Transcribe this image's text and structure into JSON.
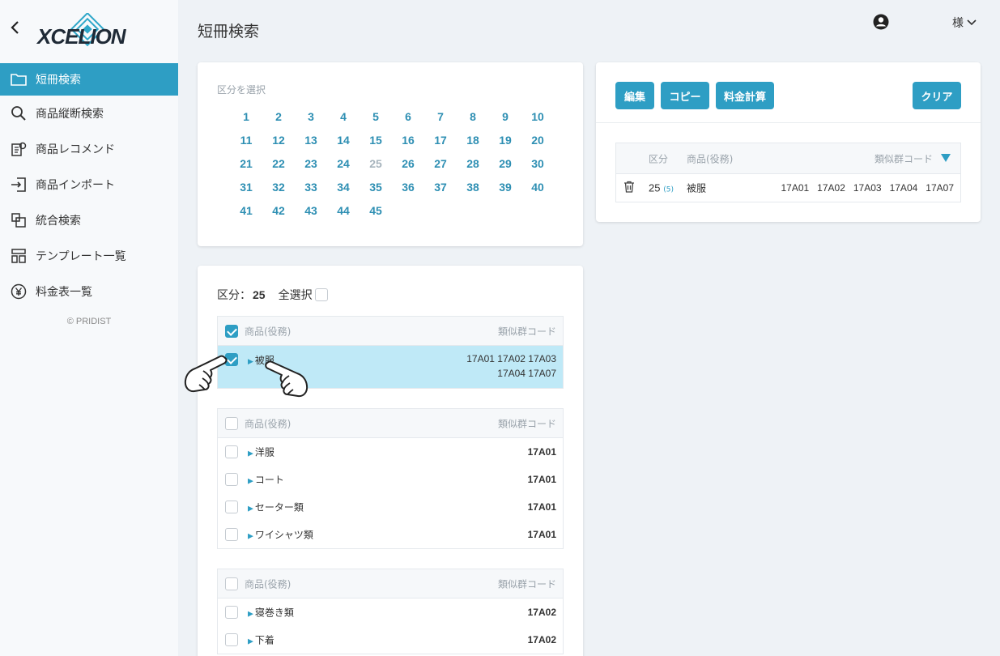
{
  "sidebar": {
    "items": [
      {
        "label": "短冊検索",
        "name": "sidebar-item-tanzaku-search",
        "icon": "folder-icon",
        "active": true
      },
      {
        "label": "商品縦断検索",
        "name": "sidebar-item-product-cross-search",
        "icon": "search-icon"
      },
      {
        "label": "商品レコメンド",
        "name": "sidebar-item-product-recommend",
        "icon": "recommend-icon"
      },
      {
        "label": "商品インポート",
        "name": "sidebar-item-product-import",
        "icon": "import-icon"
      },
      {
        "label": "統合検索",
        "name": "sidebar-item-integrated-search",
        "icon": "integrated-search-icon"
      },
      {
        "label": "テンプレート一覧",
        "name": "sidebar-item-template-list",
        "icon": "template-icon"
      },
      {
        "label": "料金表一覧",
        "name": "sidebar-item-fee-list",
        "icon": "yen-icon"
      }
    ],
    "copyright": "© PRIDIST"
  },
  "header": {
    "title": "短冊検索",
    "user_suffix": "様"
  },
  "class_select": {
    "label": "区分を選択",
    "numbers": [
      "1",
      "2",
      "3",
      "4",
      "5",
      "6",
      "7",
      "8",
      "9",
      "10",
      "11",
      "12",
      "13",
      "14",
      "15",
      "16",
      "17",
      "18",
      "19",
      "20",
      "21",
      "22",
      "23",
      "24",
      "25",
      "26",
      "27",
      "28",
      "29",
      "30",
      "31",
      "32",
      "33",
      "34",
      "35",
      "36",
      "37",
      "38",
      "39",
      "40",
      "41",
      "42",
      "43",
      "44",
      "45"
    ],
    "selected": "25"
  },
  "actions": {
    "edit": "編集",
    "copy": "コピー",
    "fee_calc": "料金計算",
    "clear": "クリア"
  },
  "summary_table": {
    "headers": {
      "kubun": "区分",
      "product": "商品(役務)",
      "codes": "類似群コード"
    },
    "rows": [
      {
        "kubun": "25",
        "count": "(5)",
        "product": "被服",
        "codes": "17A01   17A02   17A03   17A04   17A07"
      }
    ]
  },
  "list": {
    "kubun_label": "区分：",
    "kubun_value": "25",
    "select_all": "全選択",
    "header_product": "商品(役務)",
    "header_codes": "類似群コード",
    "groups": [
      {
        "checked": true,
        "rows": [
          {
            "name": "被服",
            "codes_line1": "17A01 17A02 17A03",
            "codes_line2": "17A04 17A07",
            "checked": true
          }
        ]
      },
      {
        "checked": false,
        "rows": [
          {
            "name": "洋服",
            "codes_line1": "17A01"
          },
          {
            "name": "コート",
            "codes_line1": "17A01"
          },
          {
            "name": "セーター類",
            "codes_line1": "17A01"
          },
          {
            "name": "ワイシャツ類",
            "codes_line1": "17A01"
          }
        ]
      },
      {
        "checked": false,
        "rows": [
          {
            "name": "寝巻き類",
            "codes_line1": "17A02"
          },
          {
            "name": "下着",
            "codes_line1": "17A02"
          }
        ]
      }
    ]
  },
  "colors": {
    "accent": "#2e9ec4",
    "selected_row": "#bfe9f7",
    "background": "#eef2f6"
  }
}
